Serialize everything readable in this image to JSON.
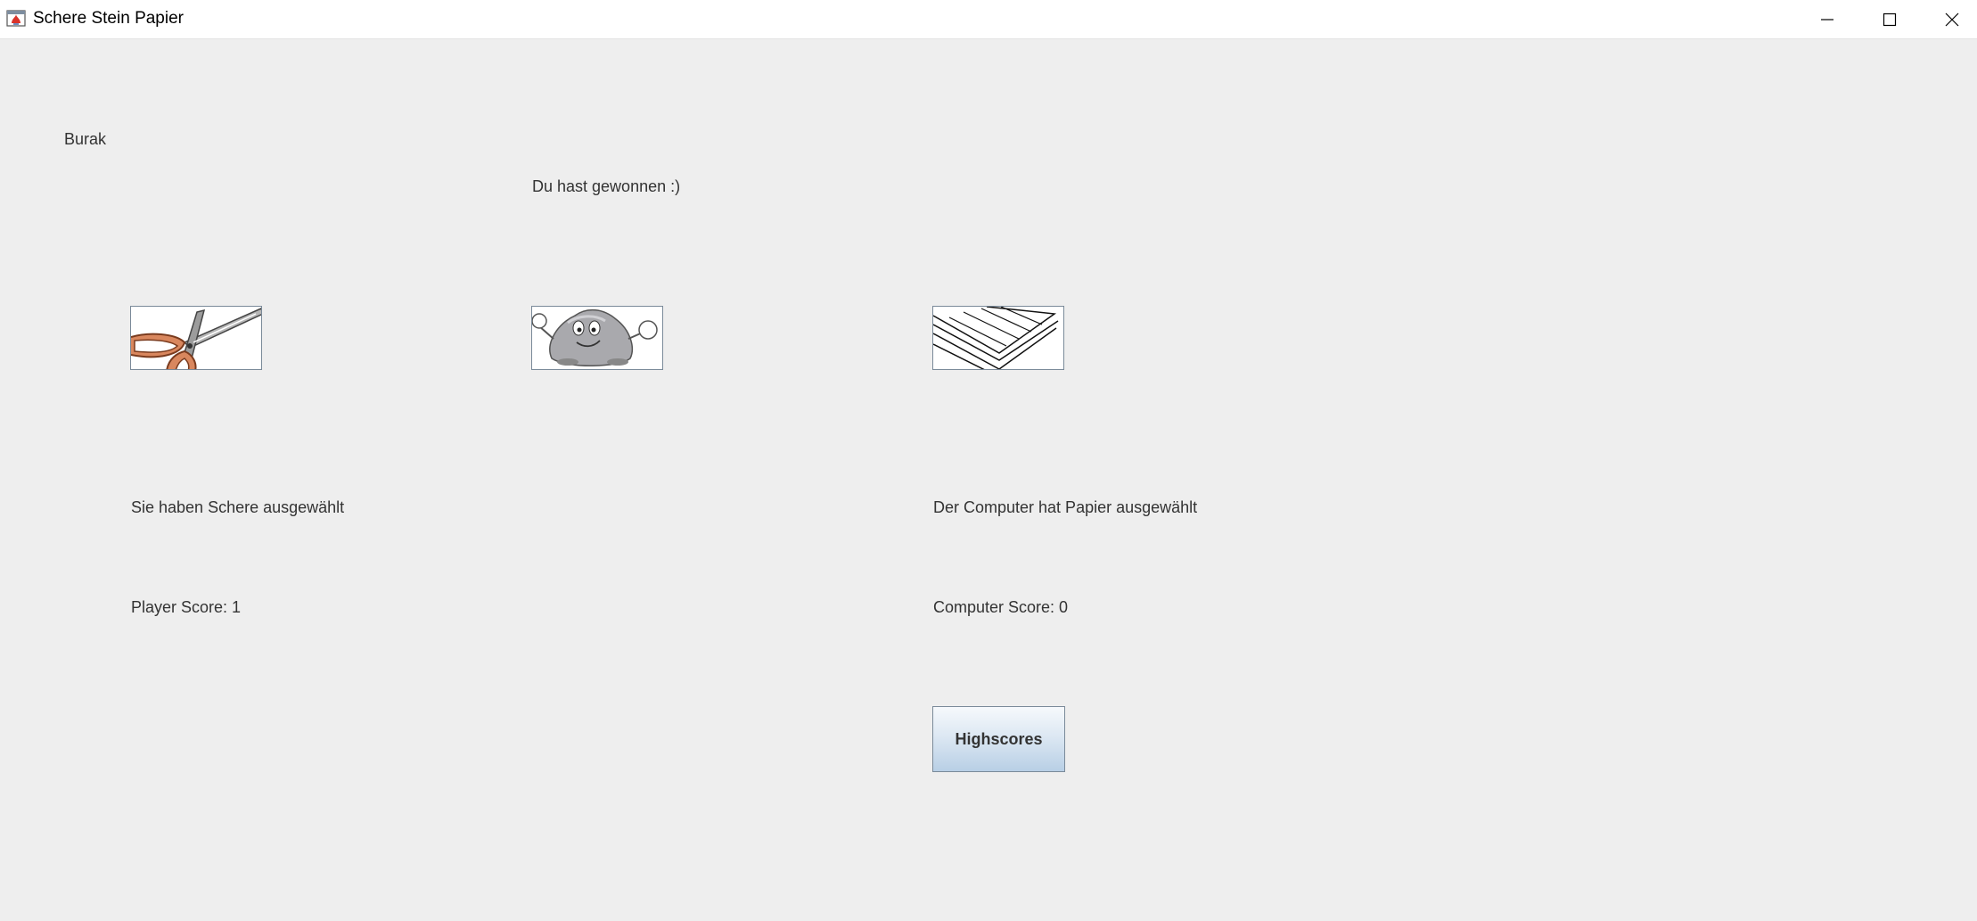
{
  "window": {
    "title": "Schere Stein Papier",
    "icon": "java-app-icon",
    "controls": [
      "minimize-icon",
      "maximize-icon",
      "close-icon"
    ]
  },
  "player": {
    "name": "Burak",
    "selection_text": "Sie haben Schere ausgewählt",
    "score_text": "Player Score: 1"
  },
  "result": {
    "message": "Du hast gewonnen :)"
  },
  "choices": [
    {
      "id": "schere",
      "icon": "scissors-icon"
    },
    {
      "id": "stein",
      "icon": "rock-icon"
    },
    {
      "id": "papier",
      "icon": "paper-icon"
    }
  ],
  "computer": {
    "selection_text": "Der Computer hat Papier ausgewählt",
    "score_text": "Computer Score: 0"
  },
  "actions": {
    "highscores_label": "Highscores"
  },
  "colors": {
    "background": "#eeeeee",
    "titlebar": "#ffffff",
    "text": "#333333",
    "button_border": "#7a8a99"
  }
}
